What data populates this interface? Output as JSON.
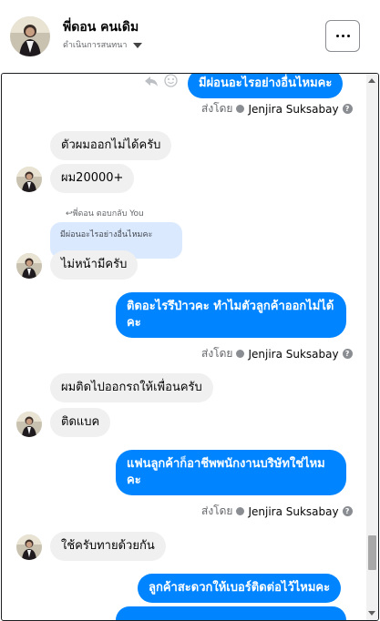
{
  "header": {
    "name": "พี่ดอน คนเดิม",
    "subtitle": "ดำเนินการสนทนา",
    "more_label": "..."
  },
  "chat": {
    "messages": [
      {
        "from": "page",
        "text": "มีผ่อนอะไรอย่างอื่นไหมคะ"
      },
      {
        "from": "customer",
        "text": "ตัวผมออกไม่ได้ครับ"
      },
      {
        "from": "customer",
        "text": "ผม20000+"
      },
      {
        "from": "customer",
        "text": "ไม่หน้ามีครับ"
      },
      {
        "from": "page",
        "text": "ติดอะไรรึป่าวคะ ทำไมตัวลูกค้าออกไม่ได้คะ"
      },
      {
        "from": "customer",
        "text": "ผมติดไปออกรถให้เพื่อนครับ"
      },
      {
        "from": "customer",
        "text": "ติดแบค"
      },
      {
        "from": "page",
        "text": "แฟนลูกค้าก็อาชีพพนักงานบริษัทใช่ไหมคะ"
      },
      {
        "from": "customer",
        "text": "ใช้ครับทายด้วยกัน"
      },
      {
        "from": "page",
        "text": "ลูกค้าสะดวกให้เบอร์ติดต่อไว้ไหมคะ"
      }
    ],
    "seen_prefix": "ส่งโดย",
    "seen_by": "Jenjira Suksabay",
    "reply_label": "พี่ดอน ตอบกลับ You",
    "quoted_text": "มีผ่อนอะไรอย่างอื่นไหมคะ"
  },
  "colors": {
    "accent": "#0084ff",
    "incoming": "#f0f0f0",
    "quote": "#dbe9ff"
  },
  "icons": [
    "reply-icon",
    "emoji-icon",
    "more-icon",
    "verified-icon",
    "help-icon"
  ]
}
